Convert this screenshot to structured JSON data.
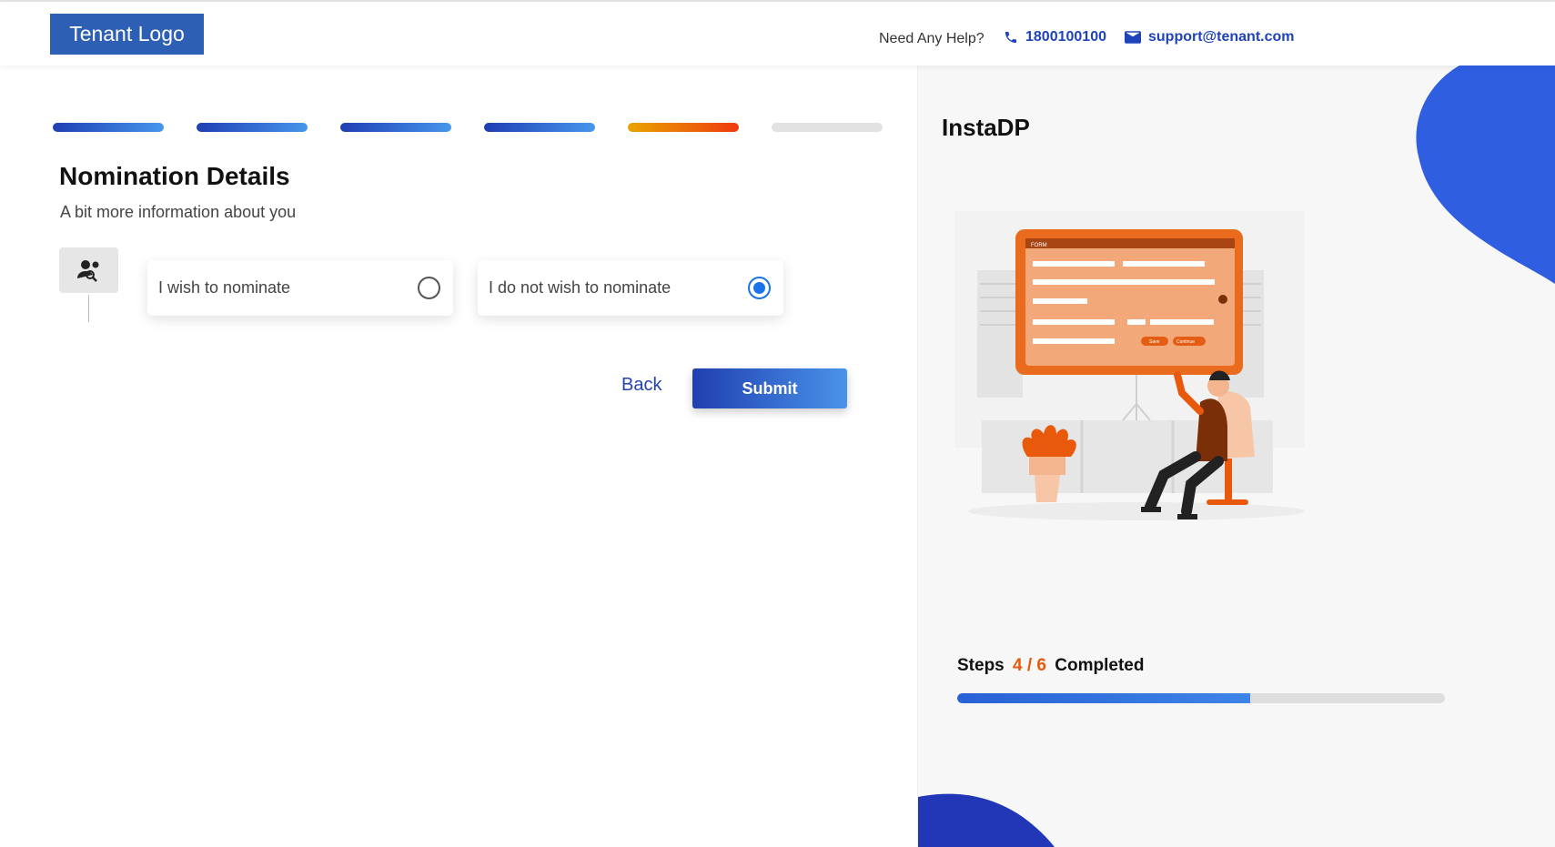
{
  "header": {
    "logo_text": "Tenant Logo",
    "help_text": "Need Any Help?",
    "phone": "1800100100",
    "email": "support@tenant.com",
    "phone_icon": "phone-icon",
    "email_icon": "mail-icon"
  },
  "progress": {
    "total_steps": 6,
    "states": [
      "done",
      "done",
      "done",
      "done",
      "current",
      "todo"
    ]
  },
  "form": {
    "title": "Nomination Details",
    "subtitle": "A bit more information about you",
    "step_icon": "nominee-search-icon",
    "options": [
      {
        "label": "I wish to nominate",
        "selected": false
      },
      {
        "label": "I do not wish to nominate",
        "selected": true
      }
    ],
    "back_label": "Back",
    "submit_label": "Submit"
  },
  "sidebar": {
    "brand": "InstaDP",
    "steps_prefix": "Steps",
    "steps_count": "4 / 6",
    "steps_suffix": "Completed",
    "completed_fraction": 0.6
  },
  "illustration": {
    "form_title": "FORM",
    "save_label": "Save",
    "continue_label": "Continue"
  },
  "colors": {
    "accent_blue": "#203fb0",
    "accent_orange": "#e8590c",
    "logo_bg": "#2d5fb4"
  }
}
